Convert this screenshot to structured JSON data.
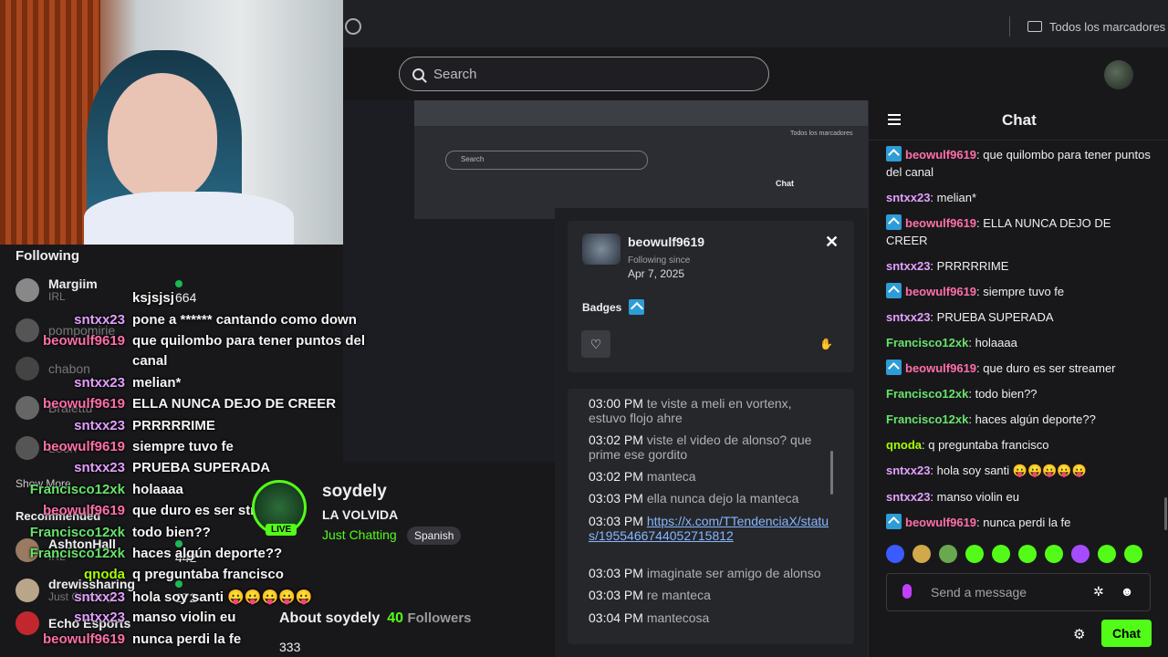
{
  "browser": {
    "bookmarks_label": "Todos los marcadores"
  },
  "search": {
    "placeholder": "Search"
  },
  "following": {
    "title": "Following",
    "items": [
      {
        "name": "Margiim",
        "category": "IRL",
        "viewers": "664"
      },
      {
        "name": "pompomirie"
      },
      {
        "name": "chabon"
      },
      {
        "name": "Bralettu"
      },
      {
        "name": "Leon"
      }
    ],
    "show_more": "Show More",
    "recommended": "Recommended",
    "rec_items": [
      {
        "name": "AshtonHall",
        "category": "IRL",
        "viewers": "442"
      },
      {
        "name": "drewissharing",
        "category": "Just Chatting",
        "viewers": "272"
      },
      {
        "name": "Echo Esports"
      }
    ]
  },
  "overlay_chat": [
    {
      "user": "",
      "text": "ksjsjsj"
    },
    {
      "user": "sntxx23",
      "text": "pone a ****** cantando como down"
    },
    {
      "user": "beowulf9619",
      "text": "que quilombo para tener puntos del"
    },
    {
      "user": "",
      "text": "canal"
    },
    {
      "user": "sntxx23",
      "text": "melian*"
    },
    {
      "user": "beowulf9619",
      "text": "ELLA NUNCA DEJO DE CREER"
    },
    {
      "user": "sntxx23",
      "text": "PRRRRRIME"
    },
    {
      "user": "beowulf9619",
      "text": "siempre tuvo fe"
    },
    {
      "user": "sntxx23",
      "text": "PRUEBA SUPERADA"
    },
    {
      "user": "Francisco12xk",
      "text": "holaaaa"
    },
    {
      "user": "beowulf9619",
      "text": "que duro es ser streamer"
    },
    {
      "user": "Francisco12xk",
      "text": "todo bien??"
    },
    {
      "user": "Francisco12xk",
      "text": "haces algún deporte??"
    },
    {
      "user": "qnoda",
      "text": "q preguntaba francisco"
    },
    {
      "user": "sntxx23",
      "text": "hola soy santi 😛😛😛😛😛"
    },
    {
      "user": "sntxx23",
      "text": "manso violin eu"
    },
    {
      "user": "beowulf9619",
      "text": "nunca perdi la fe"
    }
  ],
  "streamer": {
    "name": "soydely",
    "title": "LA VOLVIDA",
    "category": "Just Chatting",
    "language": "Spanish",
    "live": "LIVE",
    "about": "About soydely",
    "followers_count": "40",
    "followers_label": "Followers",
    "about_extra": "333"
  },
  "card": {
    "username": "beowulf9619",
    "following_since_label": "Following since",
    "following_date": "Apr 7, 2025",
    "badges_label": "Badges",
    "history": [
      {
        "time": "03:00 PM",
        "text": "te viste a meli en vortenx, estuvo flojo ahre"
      },
      {
        "time": "03:02 PM",
        "text": "viste el video de alonso? que prime ese gordito"
      },
      {
        "time": "03:02 PM",
        "text": "manteca"
      },
      {
        "time": "03:03 PM",
        "text": "ella nunca dejo la manteca"
      },
      {
        "time": "03:03 PM",
        "text": "https://x.com/TTendenciaX/status/1955466744052715812",
        "link": true
      },
      {
        "time": "03:03 PM",
        "text": "imaginate ser amigo de alonso"
      },
      {
        "time": "03:03 PM",
        "text": "re manteca"
      },
      {
        "time": "03:04 PM",
        "text": "mantecosa"
      }
    ]
  },
  "chat": {
    "title": "Chat",
    "messages": [
      {
        "user": "beowulf9619",
        "badge": true,
        "text": "que quilombo para tener puntos del canal"
      },
      {
        "user": "sntxx23",
        "text": "melian*"
      },
      {
        "user": "beowulf9619",
        "badge": true,
        "text": "ELLA NUNCA DEJO DE CREER"
      },
      {
        "user": "sntxx23",
        "text": "PRRRRRIME"
      },
      {
        "user": "beowulf9619",
        "badge": true,
        "text": "siempre tuvo fe"
      },
      {
        "user": "sntxx23",
        "text": "PRUEBA SUPERADA"
      },
      {
        "user": "Francisco12xk",
        "text": "holaaaa"
      },
      {
        "user": "beowulf9619",
        "badge": true,
        "text": "que duro es ser streamer"
      },
      {
        "user": "Francisco12xk",
        "text": "todo bien??"
      },
      {
        "user": "Francisco12xk",
        "text": "haces algún deporte??"
      },
      {
        "user": "qnoda",
        "text": "q preguntaba francisco"
      },
      {
        "user": "sntxx23",
        "text": "hola soy santi 😛😛😛😛😛"
      },
      {
        "user": "sntxx23",
        "text": "manso violin eu"
      },
      {
        "user": "beowulf9619",
        "badge": true,
        "text": "nunca perdi la fe"
      }
    ],
    "input_placeholder": "Send a message",
    "send_label": "Chat"
  },
  "colors": {
    "accent": "#53fc18",
    "beowulf9619": "#ff6fa8",
    "sntxx23": "#e3a0ff",
    "Francisco12xk": "#67e36b",
    "qnoda": "#a6ff00"
  }
}
